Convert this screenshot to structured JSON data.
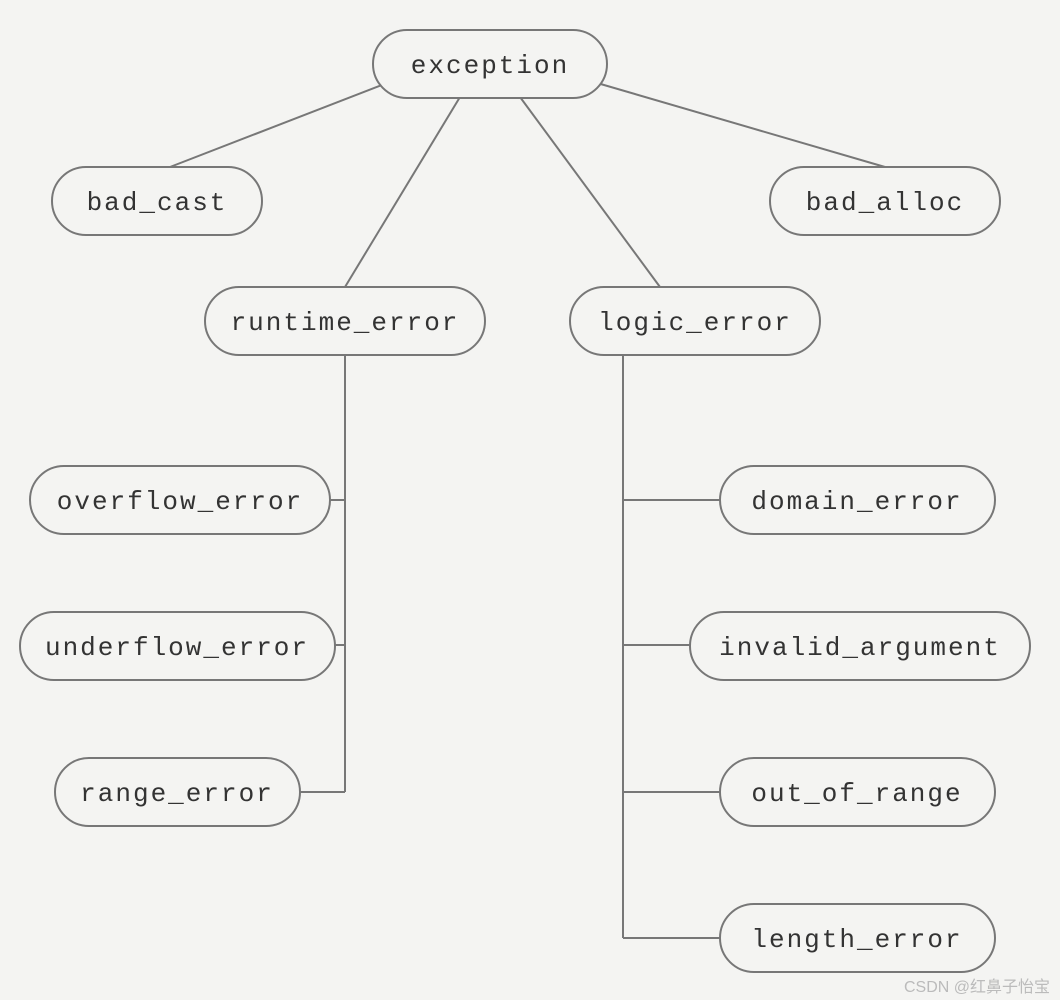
{
  "nodes": {
    "root": "exception",
    "bad_cast": "bad_cast",
    "bad_alloc": "bad_alloc",
    "runtime_error": "runtime_error",
    "logic_error": "logic_error",
    "overflow_error": "overflow_error",
    "underflow_error": "underflow_error",
    "range_error": "range_error",
    "domain_error": "domain_error",
    "invalid_argument": "invalid_argument",
    "out_of_range": "out_of_range",
    "length_error": "length_error"
  },
  "watermark": "CSDN @红鼻子怡宝",
  "colors": {
    "stroke": "#777",
    "bg": "#f4f4f2"
  }
}
